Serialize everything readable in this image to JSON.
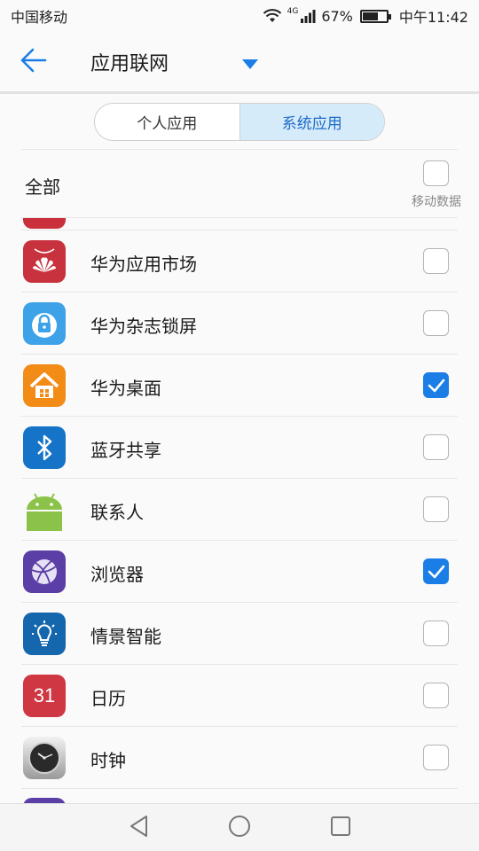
{
  "status": {
    "carrier": "中国移动",
    "network": "4G",
    "battery": "67%",
    "battery_level": 0.67,
    "time": "中午11:42"
  },
  "appbar": {
    "title": "应用联网"
  },
  "tabs": [
    {
      "label": "个人应用",
      "active": false
    },
    {
      "label": "系统应用",
      "active": true
    }
  ],
  "all_row": {
    "label": "全部",
    "column_label": "移动数据",
    "checked": false
  },
  "apps": [
    {
      "name": "华为应用市场",
      "icon": "huawei-appgallery-icon",
      "checked": false
    },
    {
      "name": "华为杂志锁屏",
      "icon": "lock-icon",
      "checked": false
    },
    {
      "name": "华为桌面",
      "icon": "home-icon",
      "checked": true
    },
    {
      "name": "蓝牙共享",
      "icon": "bluetooth-icon",
      "checked": false
    },
    {
      "name": "联系人",
      "icon": "android-icon",
      "checked": false
    },
    {
      "name": "浏览器",
      "icon": "browser-icon",
      "checked": true
    },
    {
      "name": "情景智能",
      "icon": "bulb-icon",
      "checked": false
    },
    {
      "name": "日历",
      "icon": "calendar-icon",
      "checked": false,
      "icon_text": "31"
    },
    {
      "name": "时钟",
      "icon": "clock-icon",
      "checked": false
    }
  ],
  "colors": {
    "accent": "#1b7ee6",
    "tab_active_bg": "#d6ebfa",
    "divider": "#e6e6e6"
  }
}
